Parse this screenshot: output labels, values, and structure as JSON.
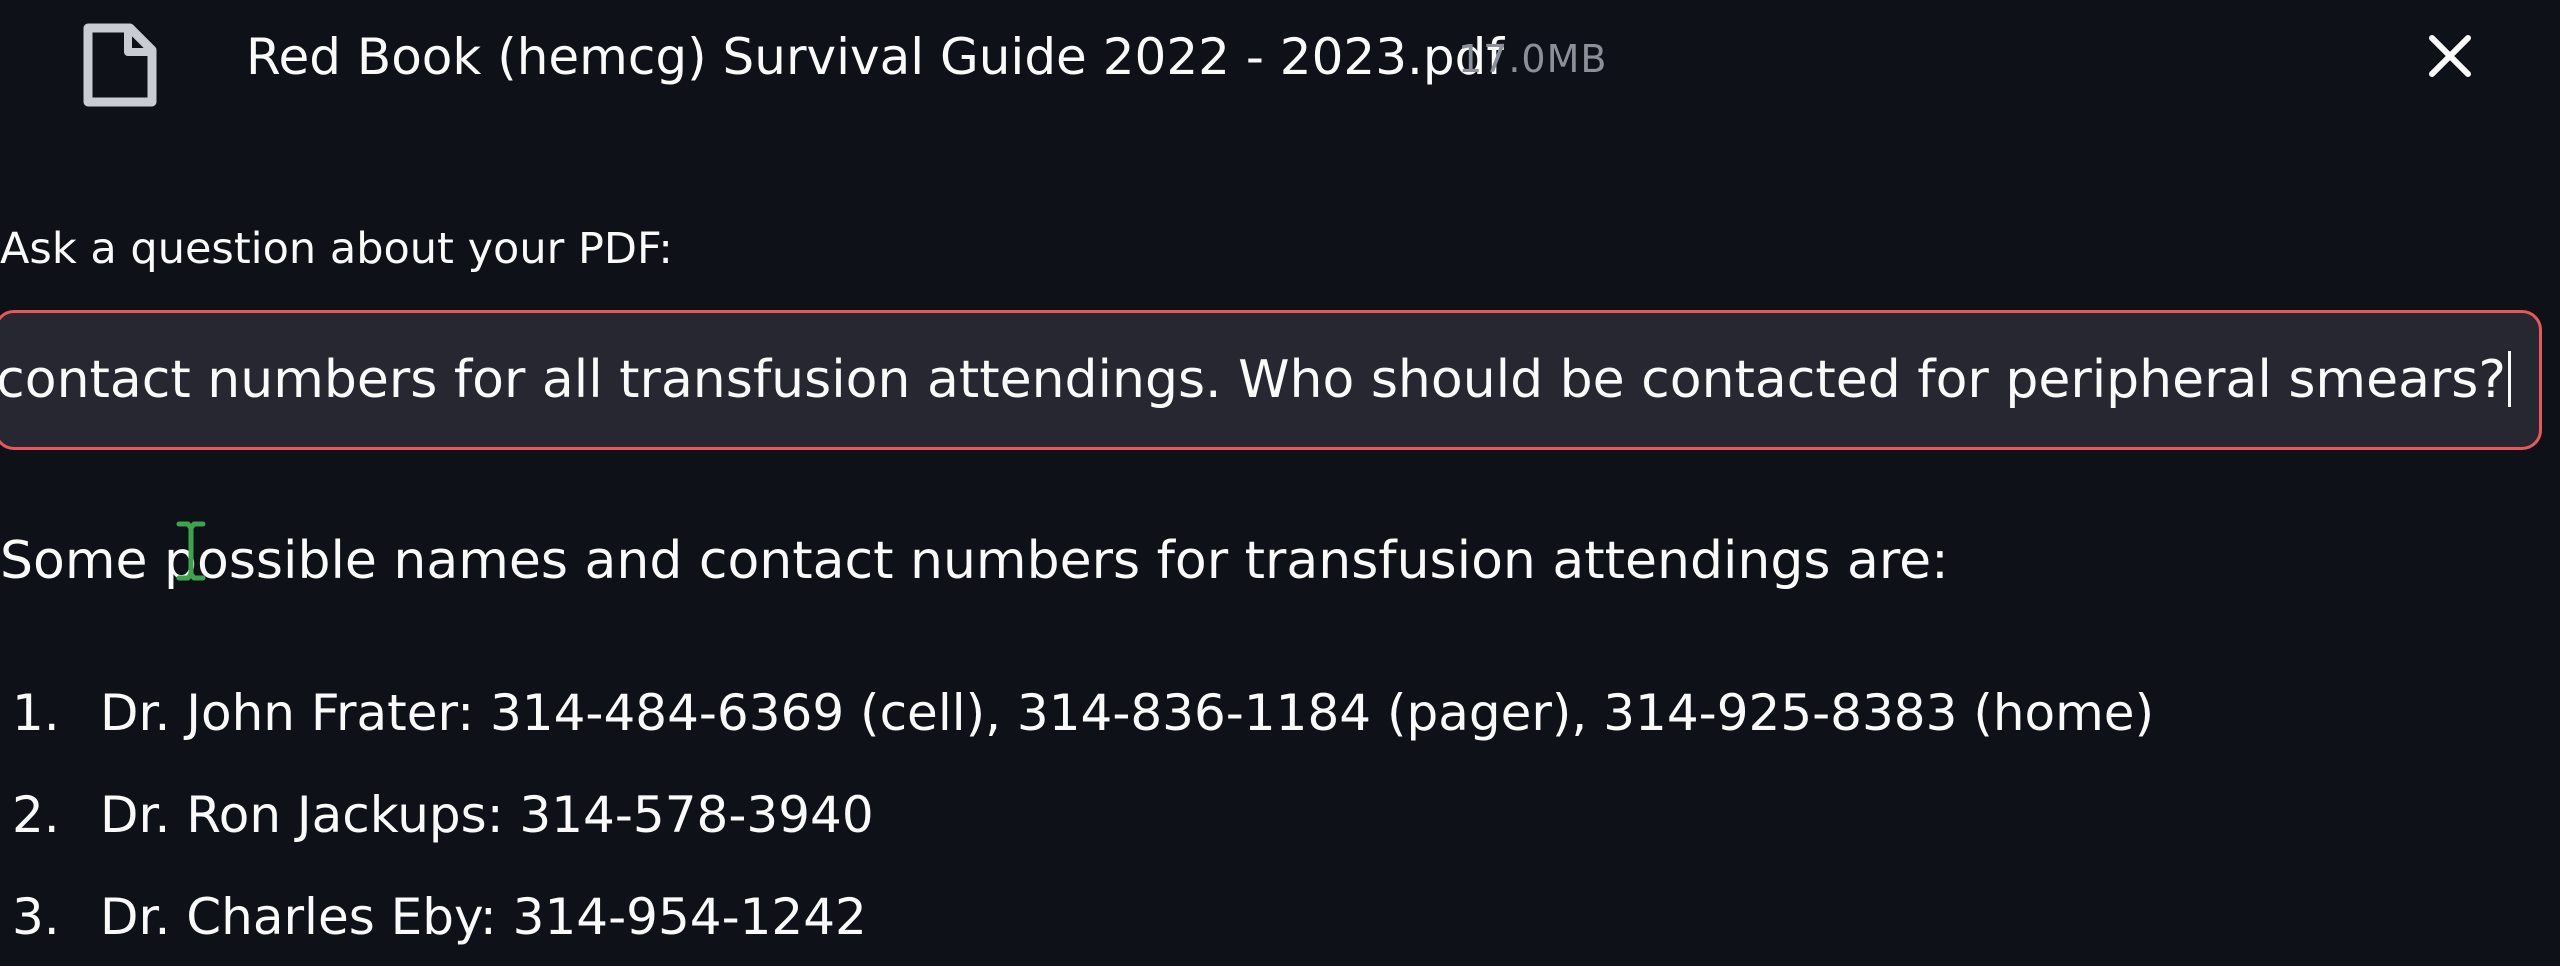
{
  "file": {
    "icon": "file-icon",
    "name": "Red Book (hemcg) Survival Guide 2022 - 2023.pdf",
    "size": "17.0MB",
    "close_icon": "close-icon"
  },
  "question": {
    "label": "Ask a question about your PDF:",
    "value": "Provide names and contact numbers for all transfusion attendings. Who should be contacted for peripheral smears?"
  },
  "answer": {
    "intro": "Some possible names and contact numbers for transfusion attendings are:",
    "items": [
      {
        "num": "1.",
        "text": "Dr. John Frater: 314-484-6369 (cell), 314-836-1184 (pager), 314-925-8383 (home)"
      },
      {
        "num": "2.",
        "text": "Dr. Ron Jackups: 314-578-3940"
      },
      {
        "num": "3.",
        "text": "Dr. Charles Eby: 314-954-1242"
      }
    ]
  },
  "colors": {
    "background": "#0e1117",
    "input_background": "#262730",
    "input_focus_border": "#e6585c",
    "muted_text": "#8b8f99",
    "cursor": "#3fa34d"
  }
}
